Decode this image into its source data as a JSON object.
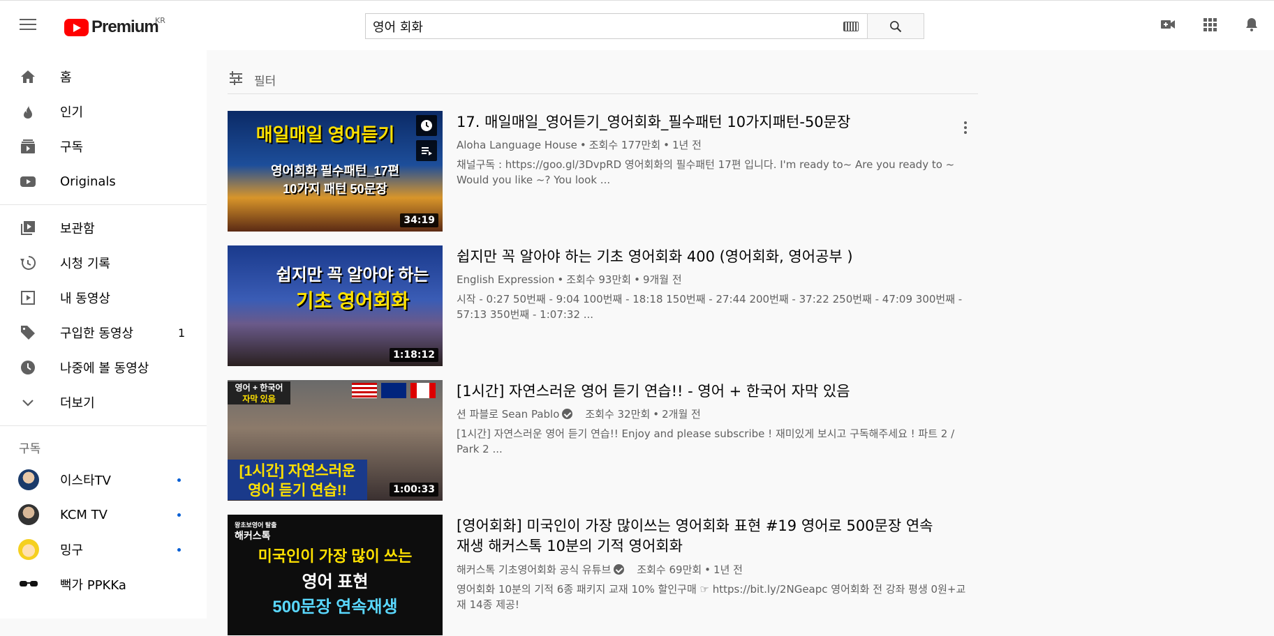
{
  "header": {
    "logo_text": "Premium",
    "region": "KR",
    "search_value": "영어 회화"
  },
  "sidebar": {
    "items": [
      {
        "label": "홈",
        "icon": "home-icon"
      },
      {
        "label": "인기",
        "icon": "trending-icon"
      },
      {
        "label": "구독",
        "icon": "subscriptions-icon"
      },
      {
        "label": "Originals",
        "icon": "originals-icon"
      }
    ],
    "library": [
      {
        "label": "보관함",
        "icon": "library-icon"
      },
      {
        "label": "시청 기록",
        "icon": "history-icon"
      },
      {
        "label": "내 동영상",
        "icon": "your-videos-icon"
      },
      {
        "label": "구입한 동영상",
        "icon": "purchases-icon",
        "count": "1"
      },
      {
        "label": "나중에 볼 동영상",
        "icon": "watch-later-icon"
      },
      {
        "label": "더보기",
        "icon": "chevron-down-icon"
      }
    ],
    "subscriptions_title": "구독",
    "subscriptions": [
      {
        "name": "이스타TV"
      },
      {
        "name": "KCM TV"
      },
      {
        "name": "밍구"
      },
      {
        "name": "뻑가 PPKKa"
      }
    ]
  },
  "filter_label": "필터",
  "videos": [
    {
      "title": "17. 매일매일_영어듣기_영어회화_필수패턴 10가지패턴-50문장",
      "channel": "Aloha Language House",
      "views": "조회수 177만회",
      "age": "1년 전",
      "desc": "채널구독 : https://goo.gl/3DvpRD 영어회화의 필수패턴 17편 입니다. I'm ready to~ Are you ready to ~ Would you like ~? You look ...",
      "duration": "34:19",
      "thumb_line1": "매일매일 영어듣기",
      "thumb_line2": "영어회화 필수패턴_17편",
      "thumb_line3": "10가지 패턴  50문장"
    },
    {
      "title": "쉽지만 꼭 알아야 하는 기초 영어회화 400 (영어회화, 영어공부 )",
      "channel": "English Expression",
      "views": "조회수 93만회",
      "age": "9개월 전",
      "desc": "시작 - 0:27 50번째 - 9:04 100번째 - 18:18 150번째 - 27:44 200번째 - 37:22 250번째 - 47:09 300번째 - 57:13 350번째 - 1:07:32 ...",
      "duration": "1:18:12",
      "thumb_line1": "쉽지만 꼭 알아야 하는",
      "thumb_line2": "기초 영어회화"
    },
    {
      "title": "[1시간] 자연스러운 영어 듣기 연습!! - 영어 + 한국어 자막 있음",
      "channel": "션 파블로 Sean Pablo",
      "views": "조회수 32만회",
      "age": "2개월 전",
      "desc": "[1시간] 자연스러운 영어 듣기 연습!! Enjoy and please subscribe ! 재미있게 보시고 구독해주세요 ! 파트 2 / Park 2 ...",
      "duration": "1:00:33",
      "thumb_line1": "영어 + 한국어",
      "thumb_line2": "자막 있음",
      "thumb_line3": "[1시간] 자연스러운",
      "thumb_line4": "영어 듣기 연습!!"
    },
    {
      "title": "[영어회화] 미국인이 가장 많이쓰는 영어회화 표현 #19 영어로 500문장 연속 재생 해커스톡 10분의 기적 영어회화",
      "channel": "해커스톡 기초영어회화 공식 유튜브",
      "views": "조회수 69만회",
      "age": "1년 전",
      "desc": "영어회화 10분의 기적 6종 패키지 교재 10% 할인구매 ☞ https://bit.ly/2NGeapc 영어회화 전 강좌 평생 0원+교재 14종 제공!",
      "thumb_line0": "왕초보영어 탈출",
      "thumb_line1": "해커스톡",
      "thumb_line2": "미국인이 가장 많이 쓰는",
      "thumb_line3": "영어 표현",
      "thumb_line4": "500문장 연속재생"
    }
  ],
  "meta_separator": "•",
  "colors": {
    "brand": "#ff0000",
    "sub_dot": "#065fd4",
    "text_secondary": "#606060"
  }
}
